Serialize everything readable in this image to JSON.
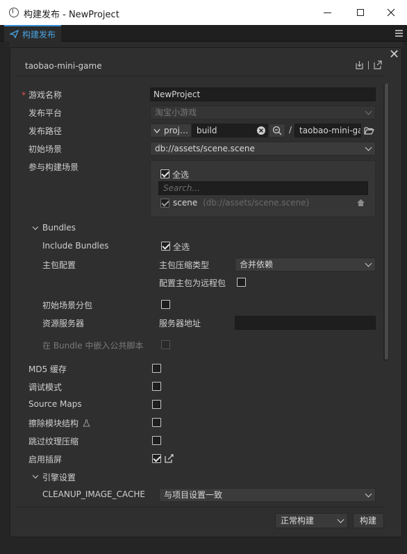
{
  "window": {
    "title": "构建发布 - NewProject",
    "minimize": "—",
    "maximize": "☐",
    "close": "✕"
  },
  "tab": {
    "label": "构建发布"
  },
  "panel": {
    "platform": "taobao-mini-game",
    "close": "✕"
  },
  "form": {
    "game_name_label": "游戏名称",
    "game_name_value": "NewProject",
    "platform_label": "发布平台",
    "platform_value": "淘宝小游戏",
    "path_label": "发布路径",
    "path_prefix": "proj…",
    "path_value": "build",
    "path_separator": "/",
    "path_output": "taobao-mini-game",
    "start_scene_label": "初始场景",
    "start_scene_value": "db://assets/scene.scene",
    "scenes_label": "参与构建场景",
    "select_all": "全选",
    "search_placeholder": "Search...",
    "scene_item_name": "scene",
    "scene_item_path": "(db://assets/scene.scene)"
  },
  "bundles": {
    "section_label": "Bundles",
    "include_bundles_label": "Include Bundles",
    "include_bundles_value": "全选",
    "main_config_label": "主包配置",
    "compress_type_label": "主包压缩类型",
    "compress_type_value": "合并依赖",
    "remote_label": "配置主包为远程包",
    "start_scene_subpackage_label": "初始场景分包",
    "resource_server_label": "资源服务器",
    "server_address_label": "服务器地址",
    "server_address_value": "",
    "embed_common_label": "在 Bundle 中嵌入公共脚本"
  },
  "options": {
    "md5_label": "MD5 缓存",
    "debug_label": "调试模式",
    "sourcemaps_label": "Source Maps",
    "erase_module_label": "擦除模块结构",
    "skip_compress_label": "跳过纹理压缩",
    "splash_label": "启用插屏"
  },
  "engine": {
    "section_label": "引擎设置",
    "cleanup_label": "CLEANUP_IMAGE_CACHE",
    "cleanup_value": "与项目设置一致"
  },
  "footer": {
    "build_mode": "正常构建",
    "build_button": "构建"
  },
  "colors": {
    "accent": "#4aa3df",
    "panel_bg": "#2f2f2f",
    "required": "#e05252"
  }
}
